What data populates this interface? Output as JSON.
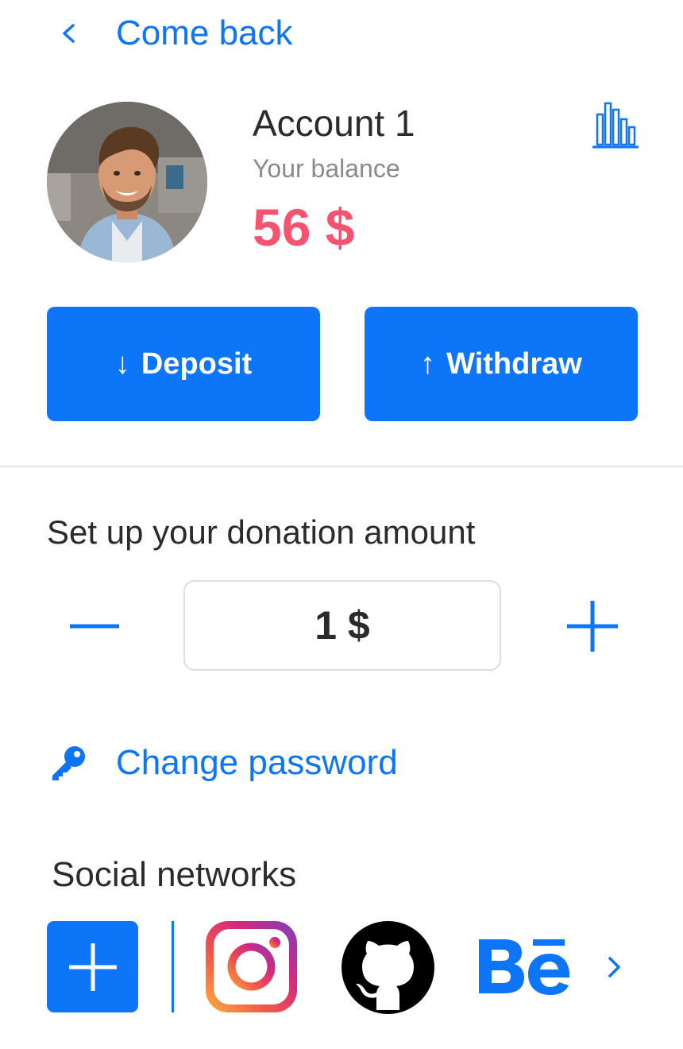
{
  "nav": {
    "back_label": "Come back"
  },
  "account": {
    "title": "Account 1",
    "balance_label": "Your balance",
    "balance_value": "56 $"
  },
  "actions": {
    "deposit_label": "Deposit",
    "withdraw_label": "Withdraw"
  },
  "donation": {
    "title": "Set up your donation amount",
    "amount": "1 $"
  },
  "password": {
    "label": "Change password"
  },
  "social": {
    "title": "Social networks",
    "items": [
      "add-social",
      "instagram",
      "github",
      "behance"
    ]
  },
  "colors": {
    "accent": "#0d75f8",
    "balance": "#f5536f",
    "text": "#2b2b2b",
    "muted": "#8a8a8a"
  },
  "icons": [
    "chevron-left-icon",
    "bar-chart-icon",
    "arrow-down-icon",
    "arrow-up-icon",
    "minus-icon",
    "plus-icon",
    "key-icon",
    "instagram-icon",
    "github-icon",
    "behance-icon",
    "chevron-right-icon"
  ]
}
